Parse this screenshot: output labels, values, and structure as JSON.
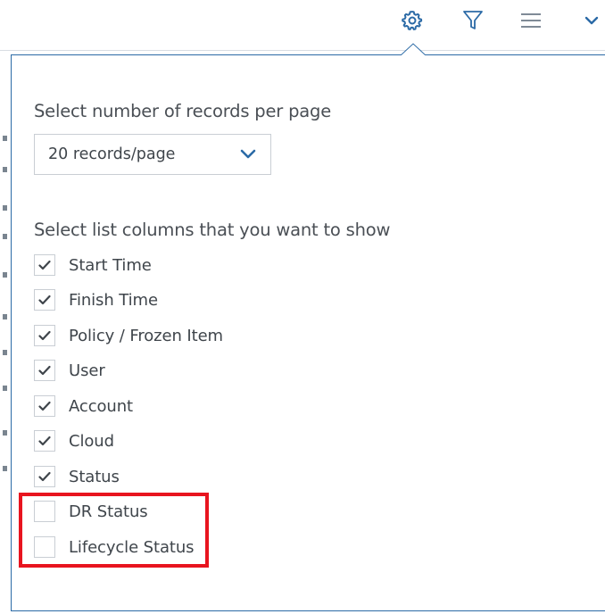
{
  "toolbar": {
    "icons": [
      "gear-icon",
      "filter-icon",
      "menu-icon",
      "chevron-down-icon"
    ],
    "accent_color": "#2b6aa6"
  },
  "settings_popover": {
    "records_label": "Select number of records per page",
    "records_select": {
      "value": "20 records/page"
    },
    "columns_label": "Select list columns that you want to show",
    "columns": [
      {
        "label": "Start Time",
        "checked": true
      },
      {
        "label": "Finish Time",
        "checked": true
      },
      {
        "label": "Policy / Frozen Item",
        "checked": true
      },
      {
        "label": "User",
        "checked": true
      },
      {
        "label": "Account",
        "checked": true
      },
      {
        "label": "Cloud",
        "checked": true
      },
      {
        "label": "Status",
        "checked": true
      },
      {
        "label": "DR Status",
        "checked": false
      },
      {
        "label": "Lifecycle Status",
        "checked": false
      }
    ],
    "highlight_color": "#e8141f"
  }
}
